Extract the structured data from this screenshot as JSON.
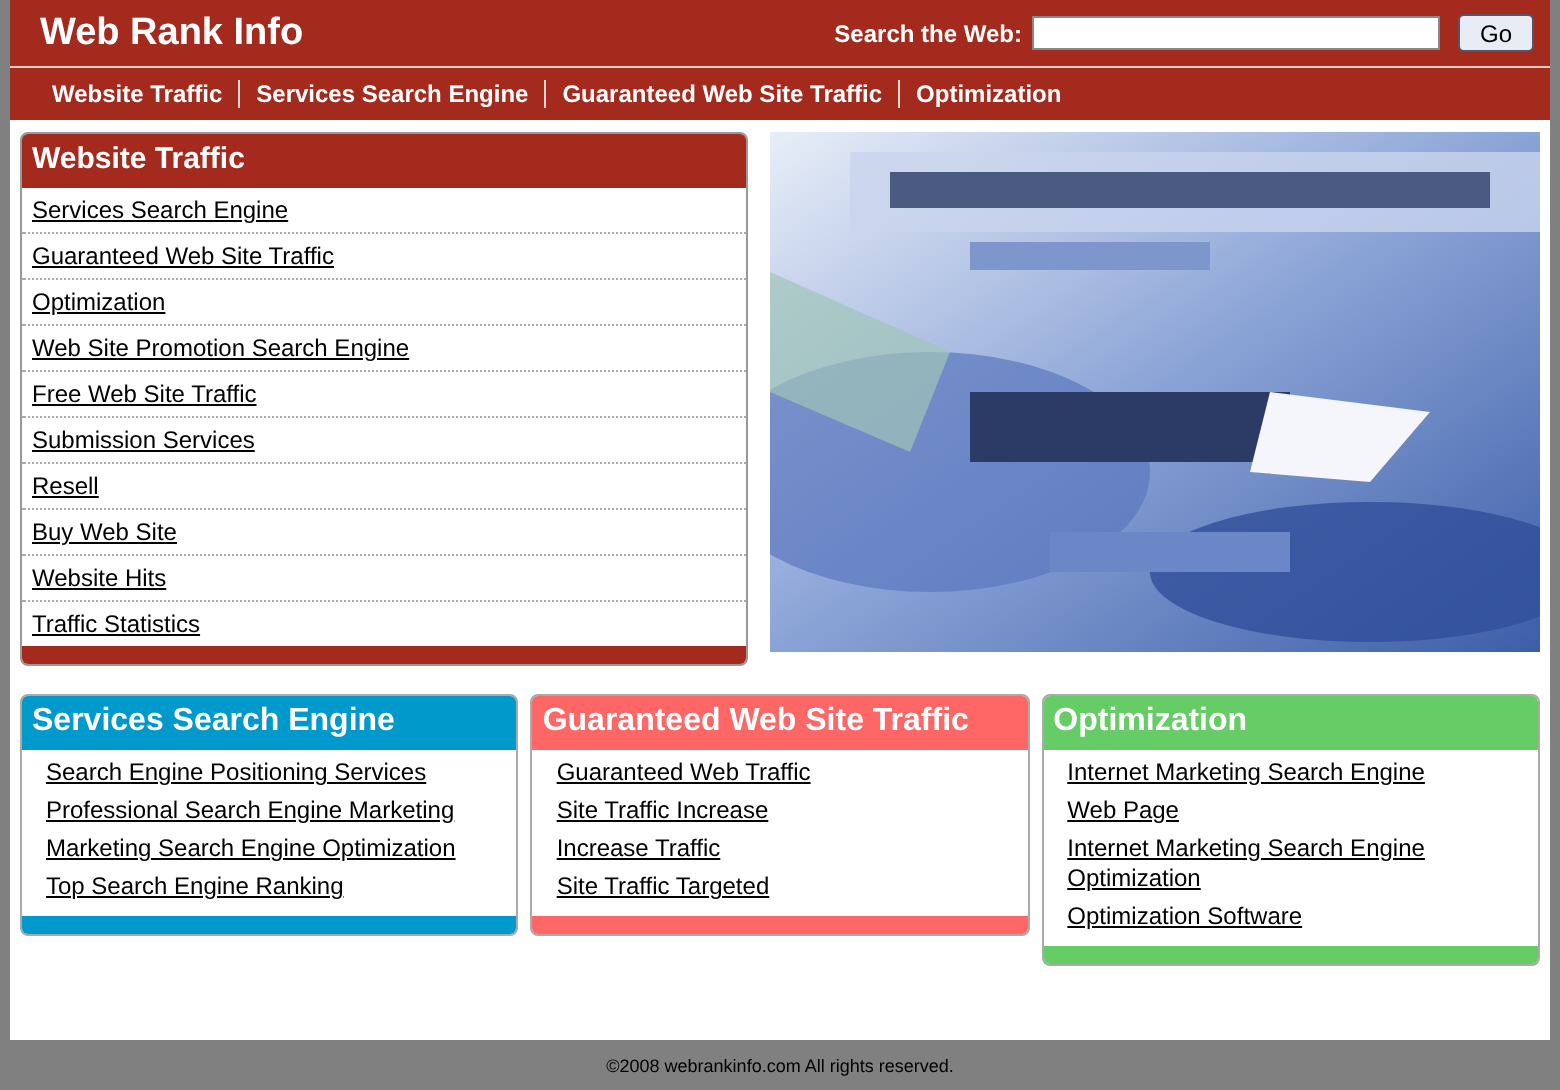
{
  "header": {
    "title": "Web Rank Info",
    "search_label": "Search the Web:",
    "search_button": "Go"
  },
  "nav": [
    "Website Traffic",
    "Services Search Engine",
    "Guaranteed Web Site Traffic",
    "Optimization"
  ],
  "main_box": {
    "title": "Website Traffic",
    "links": [
      "Services Search Engine",
      "Guaranteed Web Site Traffic",
      "Optimization",
      "Web Site Promotion Search Engine",
      "Free Web Site Traffic",
      "Submission Services",
      "Resell",
      "Buy Web Site",
      "Website Hits",
      "Traffic Statistics"
    ]
  },
  "boxes": [
    {
      "title": "Services Search Engine",
      "color": "#0099cc",
      "links": [
        "Search Engine Positioning Services",
        "Professional Search Engine Marketing",
        "Marketing Search Engine Optimization",
        "Top Search Engine Ranking"
      ]
    },
    {
      "title": "Guaranteed Web Site Traffic",
      "color": "#ff6666",
      "links": [
        "Guaranteed Web Traffic",
        "Site Traffic Increase",
        "Increase Traffic",
        "Site Traffic Targeted"
      ]
    },
    {
      "title": "Optimization",
      "color": "#66cc66",
      "links": [
        "Internet Marketing Search Engine",
        "Web Page",
        "Internet Marketing Search Engine Optimization",
        "Optimization Software"
      ]
    }
  ],
  "footer": "©2008 webrankinfo.com All rights reserved."
}
